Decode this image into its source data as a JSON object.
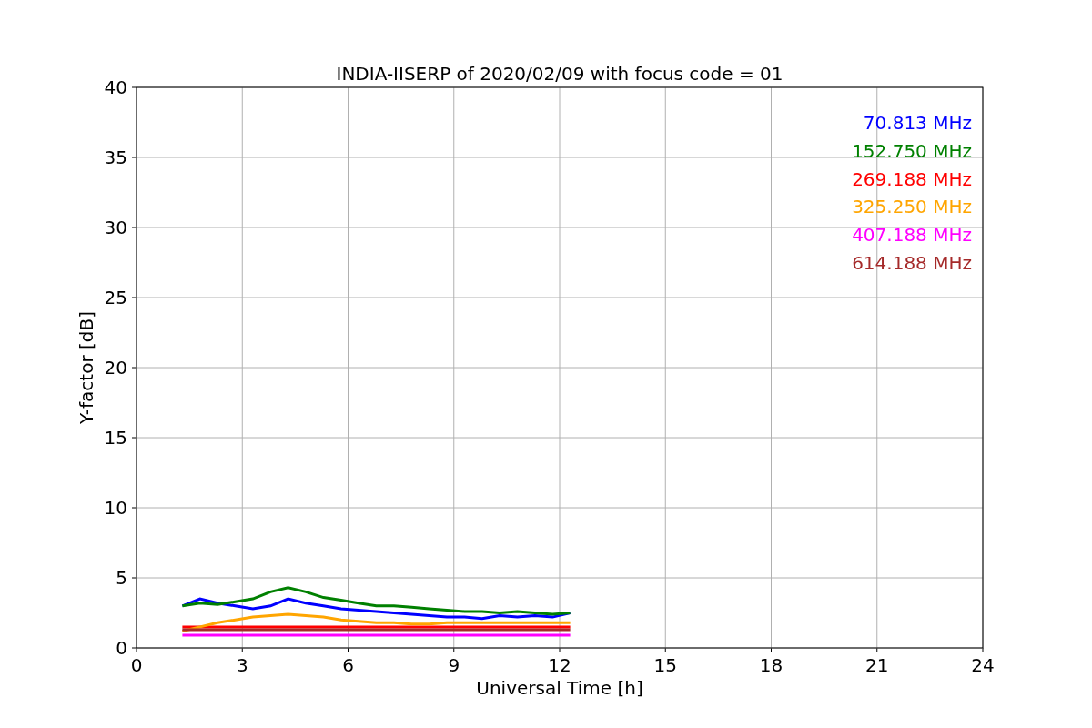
{
  "chart_data": {
    "type": "line",
    "title": "INDIA-IISERP of 2020/02/09 with focus code = 01",
    "xlabel": "Universal Time [h]",
    "ylabel": "Y-factor [dB]",
    "x": [
      1.3,
      1.8,
      2.3,
      2.8,
      3.3,
      3.8,
      4.3,
      4.8,
      5.3,
      5.8,
      6.3,
      6.8,
      7.3,
      7.8,
      8.3,
      8.8,
      9.3,
      9.8,
      10.3,
      10.8,
      11.3,
      11.8,
      12.3
    ],
    "series": [
      {
        "name": "70.813 MHz",
        "color": "#0000ff",
        "values": [
          3.0,
          3.5,
          3.2,
          3.0,
          2.8,
          3.0,
          3.5,
          3.2,
          3.0,
          2.8,
          2.7,
          2.6,
          2.5,
          2.4,
          2.3,
          2.2,
          2.2,
          2.1,
          2.3,
          2.2,
          2.3,
          2.2,
          2.5
        ]
      },
      {
        "name": "152.750 MHz",
        "color": "#008000",
        "values": [
          3.0,
          3.2,
          3.1,
          3.3,
          3.5,
          4.0,
          4.3,
          4.0,
          3.6,
          3.4,
          3.2,
          3.0,
          3.0,
          2.9,
          2.8,
          2.7,
          2.6,
          2.6,
          2.5,
          2.6,
          2.5,
          2.4,
          2.5
        ]
      },
      {
        "name": "269.188 MHz",
        "color": "#ff0000",
        "values": [
          1.5,
          1.5,
          1.5,
          1.5,
          1.5,
          1.5,
          1.5,
          1.5,
          1.5,
          1.5,
          1.5,
          1.5,
          1.5,
          1.5,
          1.5,
          1.5,
          1.5,
          1.5,
          1.5,
          1.5,
          1.5,
          1.5,
          1.5
        ]
      },
      {
        "name": "325.250 MHz",
        "color": "#ffa500",
        "values": [
          1.2,
          1.5,
          1.8,
          2.0,
          2.2,
          2.3,
          2.4,
          2.3,
          2.2,
          2.0,
          1.9,
          1.8,
          1.8,
          1.7,
          1.7,
          1.8,
          1.8,
          1.8,
          1.8,
          1.8,
          1.8,
          1.8,
          1.8
        ]
      },
      {
        "name": "407.188 MHz",
        "color": "#ff00ff",
        "values": [
          0.9,
          0.9,
          0.9,
          0.9,
          0.9,
          0.9,
          0.9,
          0.9,
          0.9,
          0.9,
          0.9,
          0.9,
          0.9,
          0.9,
          0.9,
          0.9,
          0.9,
          0.9,
          0.9,
          0.9,
          0.9,
          0.9,
          0.9
        ]
      },
      {
        "name": "614.188 MHz",
        "color": "#a52a2a",
        "values": [
          1.3,
          1.3,
          1.3,
          1.3,
          1.3,
          1.3,
          1.3,
          1.3,
          1.3,
          1.3,
          1.3,
          1.3,
          1.3,
          1.3,
          1.3,
          1.3,
          1.3,
          1.3,
          1.3,
          1.3,
          1.3,
          1.3,
          1.3
        ]
      }
    ],
    "grid": true,
    "xlim": [
      0,
      24
    ],
    "ylim": [
      0,
      40
    ],
    "xticks": [
      0,
      3,
      6,
      9,
      12,
      15,
      18,
      21,
      24
    ],
    "yticks": [
      0,
      5,
      10,
      15,
      20,
      25,
      30,
      35,
      40
    ]
  }
}
